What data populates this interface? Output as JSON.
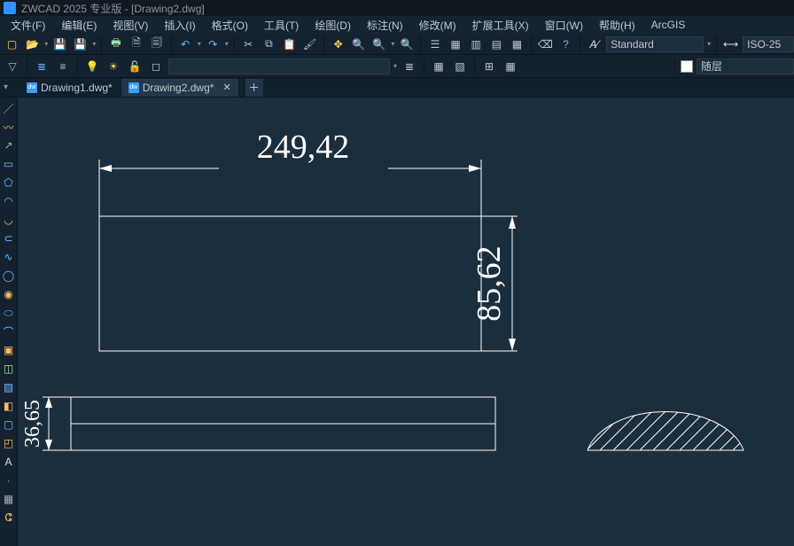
{
  "titlebar": {
    "text": "ZWCAD 2025 专业版 - [Drawing2.dwg]"
  },
  "menu": {
    "items": [
      "文件(F)",
      "编辑(E)",
      "视图(V)",
      "插入(I)",
      "格式(O)",
      "工具(T)",
      "绘图(D)",
      "标注(N)",
      "修改(M)",
      "扩展工具(X)",
      "窗口(W)",
      "帮助(H)",
      "ArcGIS"
    ]
  },
  "toolbar1": {
    "text_style": "Standard",
    "dim_style": "ISO-25"
  },
  "toolbar2": {
    "layer_state": "随层"
  },
  "tabs": {
    "inactive": {
      "label": "Drawing1.dwg*"
    },
    "active": {
      "label": "Drawing2.dwg*"
    }
  },
  "drawing": {
    "dim_top": "249,42",
    "dim_right": "85,62",
    "dim_left": "36,65"
  }
}
